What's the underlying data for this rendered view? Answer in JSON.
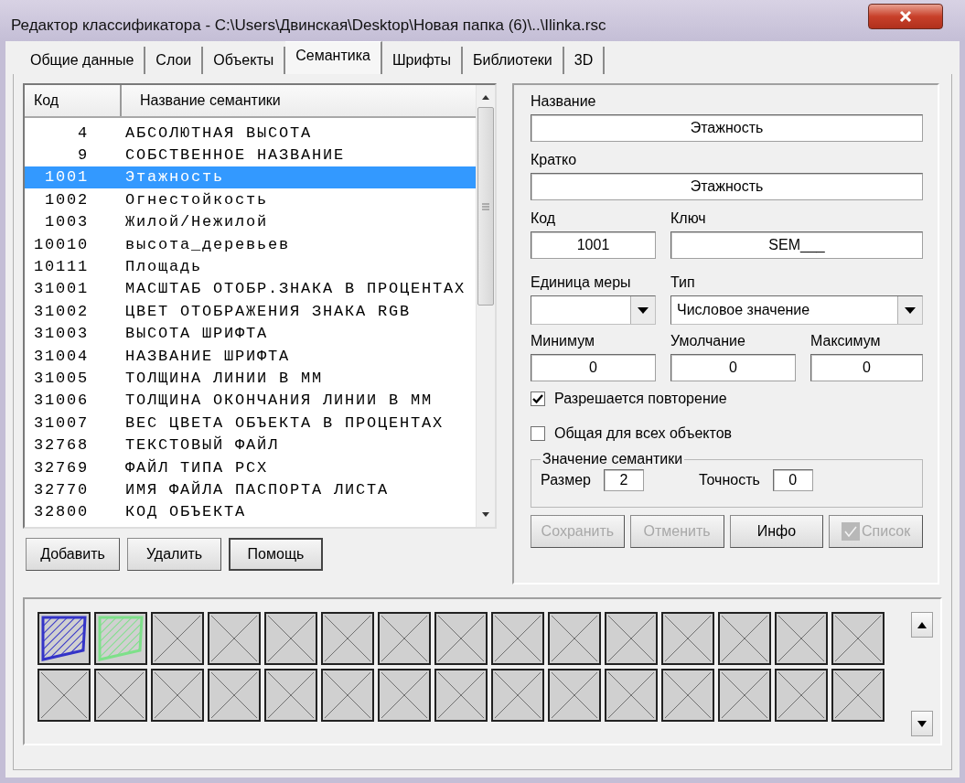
{
  "window": {
    "title": "Редактор классификатора - C:\\Users\\Двинская\\Desktop\\Новая папка (6)\\..\\Ilinka.rsc"
  },
  "tabs": [
    {
      "label": "Общие данные",
      "selected": false
    },
    {
      "label": "Слои",
      "selected": false
    },
    {
      "label": "Объекты",
      "selected": false
    },
    {
      "label": "Семантика",
      "selected": true
    },
    {
      "label": "Шрифты",
      "selected": false
    },
    {
      "label": "Библиотеки",
      "selected": false
    },
    {
      "label": "3D",
      "selected": false
    }
  ],
  "semantics_list": {
    "columns": [
      "Код",
      "Название семантики"
    ],
    "rows": [
      {
        "code": "4",
        "name": "АБСОЛЮТНАЯ ВЫСОТА",
        "selected": false
      },
      {
        "code": "9",
        "name": "СОБСТВЕННОЕ НАЗВАНИЕ",
        "selected": false
      },
      {
        "code": "1001",
        "name": "Этажность",
        "selected": true
      },
      {
        "code": "1002",
        "name": "Огнестойкость",
        "selected": false
      },
      {
        "code": "1003",
        "name": "Жилой/Нежилой",
        "selected": false
      },
      {
        "code": "10010",
        "name": "высота_деревьев",
        "selected": false
      },
      {
        "code": "10111",
        "name": "Площадь",
        "selected": false
      },
      {
        "code": "31001",
        "name": "МАСШТАБ ОТОБР.ЗНАКА В ПРОЦЕНТАХ",
        "selected": false
      },
      {
        "code": "31002",
        "name": "ЦВЕТ ОТОБРАЖЕНИЯ ЗНАКА RGB",
        "selected": false
      },
      {
        "code": "31003",
        "name": "ВЫСОТА ШРИФТА",
        "selected": false
      },
      {
        "code": "31004",
        "name": "НАЗВАНИЕ ШРИФТА",
        "selected": false
      },
      {
        "code": "31005",
        "name": "ТОЛЩИНА ЛИНИИ В ММ",
        "selected": false
      },
      {
        "code": "31006",
        "name": "ТОЛЩИНА ОКОНЧАНИЯ ЛИНИИ В ММ",
        "selected": false
      },
      {
        "code": "31007",
        "name": "ВЕС ЦВЕТА ОБЪЕКТА В ПРОЦЕНТАХ",
        "selected": false
      },
      {
        "code": "32768",
        "name": "ТЕКСТОВЫЙ ФАЙЛ",
        "selected": false
      },
      {
        "code": "32769",
        "name": "ФАЙЛ ТИПА PCX",
        "selected": false
      },
      {
        "code": "32770",
        "name": "ИМЯ ФАЙЛА ПАСПОРТА ЛИСТА",
        "selected": false
      },
      {
        "code": "32800",
        "name": "КОД ОБЪЕКТА",
        "selected": false
      }
    ]
  },
  "list_buttons": [
    {
      "label": "Добавить",
      "default": false
    },
    {
      "label": "Удалить",
      "default": false
    },
    {
      "label": "Помощь",
      "default": true
    }
  ],
  "details": {
    "name": {
      "label": "Название",
      "value": "Этажность"
    },
    "short_name": {
      "label": "Кратко",
      "value": "Этажность"
    },
    "code": {
      "label": "Код",
      "value": "1001"
    },
    "key": {
      "label": "Ключ",
      "value": "SEM___"
    },
    "unit": {
      "label": "Единица меры"
    },
    "type": {
      "label": "Тип",
      "value": "Числовое значение"
    },
    "limits": [
      {
        "label": "Минимум",
        "value": "0"
      },
      {
        "label": "Умолчание",
        "value": "0"
      },
      {
        "label": "Максимум",
        "value": "0"
      }
    ],
    "checkboxes": [
      {
        "label": "Разрешается повторение",
        "checked": true
      },
      {
        "label": "Общая для всех объектов",
        "checked": false
      }
    ],
    "value_group": {
      "title": "Значение семантики",
      "size": {
        "label": "Размер",
        "value": "2"
      },
      "precision": {
        "label": "Точность",
        "value": "0"
      }
    },
    "buttons": [
      {
        "label": "Сохранить",
        "disabled": true,
        "kind": "plain"
      },
      {
        "label": "Отменить",
        "disabled": true,
        "kind": "plain"
      },
      {
        "label": "Инфо",
        "disabled": false,
        "kind": "plain"
      },
      {
        "label": "Список",
        "disabled": true,
        "kind": "check"
      }
    ]
  },
  "palette": {
    "cells": [
      {
        "kind": "hatched",
        "color": "#3434c8"
      },
      {
        "kind": "hatched",
        "color": "#7ee08a"
      },
      {
        "kind": "empty"
      },
      {
        "kind": "empty"
      },
      {
        "kind": "empty"
      },
      {
        "kind": "empty"
      },
      {
        "kind": "empty"
      },
      {
        "kind": "empty"
      },
      {
        "kind": "empty"
      },
      {
        "kind": "empty"
      },
      {
        "kind": "empty"
      },
      {
        "kind": "empty"
      },
      {
        "kind": "empty"
      },
      {
        "kind": "empty"
      },
      {
        "kind": "empty"
      },
      {
        "kind": "empty"
      },
      {
        "kind": "empty"
      },
      {
        "kind": "empty"
      },
      {
        "kind": "empty"
      },
      {
        "kind": "empty"
      },
      {
        "kind": "empty"
      },
      {
        "kind": "empty"
      },
      {
        "kind": "empty"
      },
      {
        "kind": "empty"
      },
      {
        "kind": "empty"
      },
      {
        "kind": "empty"
      },
      {
        "kind": "empty"
      },
      {
        "kind": "empty"
      },
      {
        "kind": "empty"
      },
      {
        "kind": "empty"
      }
    ]
  }
}
